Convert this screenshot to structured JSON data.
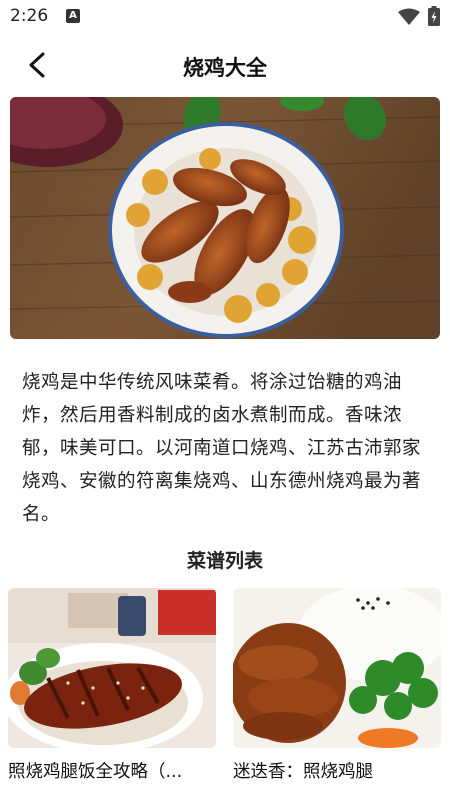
{
  "status_bar": {
    "time": "2:26",
    "notification_letter": "A"
  },
  "header": {
    "title": "烧鸡大全"
  },
  "description": "烧鸡是中华传统风味菜肴。将涂过饴糖的鸡油炸，然后用香料制成的卤水煮制而成。香味浓郁，味美可口。以河南道口烧鸡、江苏古沛郭家烧鸡、安徽的符离集烧鸡、山东德州烧鸡最为著名。",
  "section": {
    "title": "菜谱列表"
  },
  "recipes": [
    {
      "title": "照烧鸡腿饭全攻略（..."
    },
    {
      "title": "迷迭香：照烧鸡腿"
    }
  ]
}
